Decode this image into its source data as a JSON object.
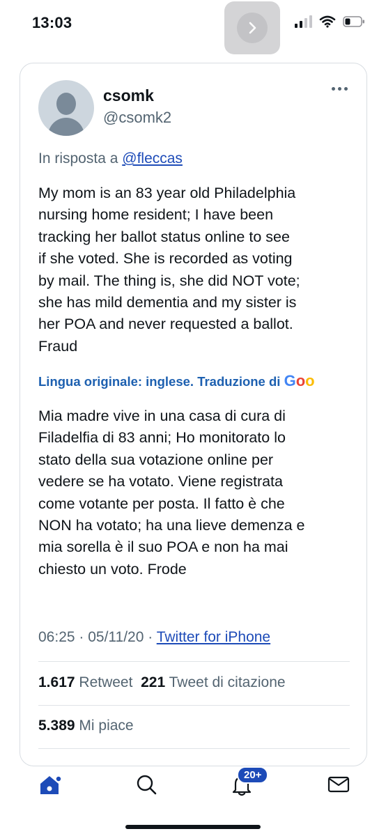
{
  "status_bar": {
    "time": "13:03"
  },
  "tweet": {
    "display_name": "csomk",
    "handle": "@csomk2",
    "reply_prefix": "In risposta a",
    "reply_to": "@fleccas",
    "text": "My mom is an 83 year old Philadelphia\nnursing home resident; I have been\ntracking her ballot status online to see\nif she voted.  She is recorded as voting\nby mail.  The thing is, she did NOT vote;\nshe has mild dementia and my sister is\nher POA and never requested a ballot.\nFraud",
    "translation_note": "Lingua originale: inglese. Traduzione di",
    "translation_provider": "Goo",
    "translated_text": "Mia madre vive in una casa di cura di\nFiladelfia di 83 anni; Ho monitorato lo\nstato della sua votazione online per\nvedere se ha votato. Viene registrata\ncome votante per posta. Il fatto è che\nNON ha votato; ha una lieve demenza e\nmia sorella è il suo POA e non ha mai\nchiesto un voto. Frode",
    "timestamp": "06:25 · 05/11/20 ·",
    "source": "Twitter for iPhone",
    "stats": {
      "retweets": "1.617",
      "retweets_label": "Retweet",
      "quotes": "221",
      "quotes_label": "Tweet di citazione",
      "likes": "5.389",
      "likes_label": "Mi piace"
    }
  },
  "tabbar": {
    "notifications_badge": "20+"
  },
  "colors": {
    "accent": "#1d4bb8",
    "muted": "#536471"
  }
}
